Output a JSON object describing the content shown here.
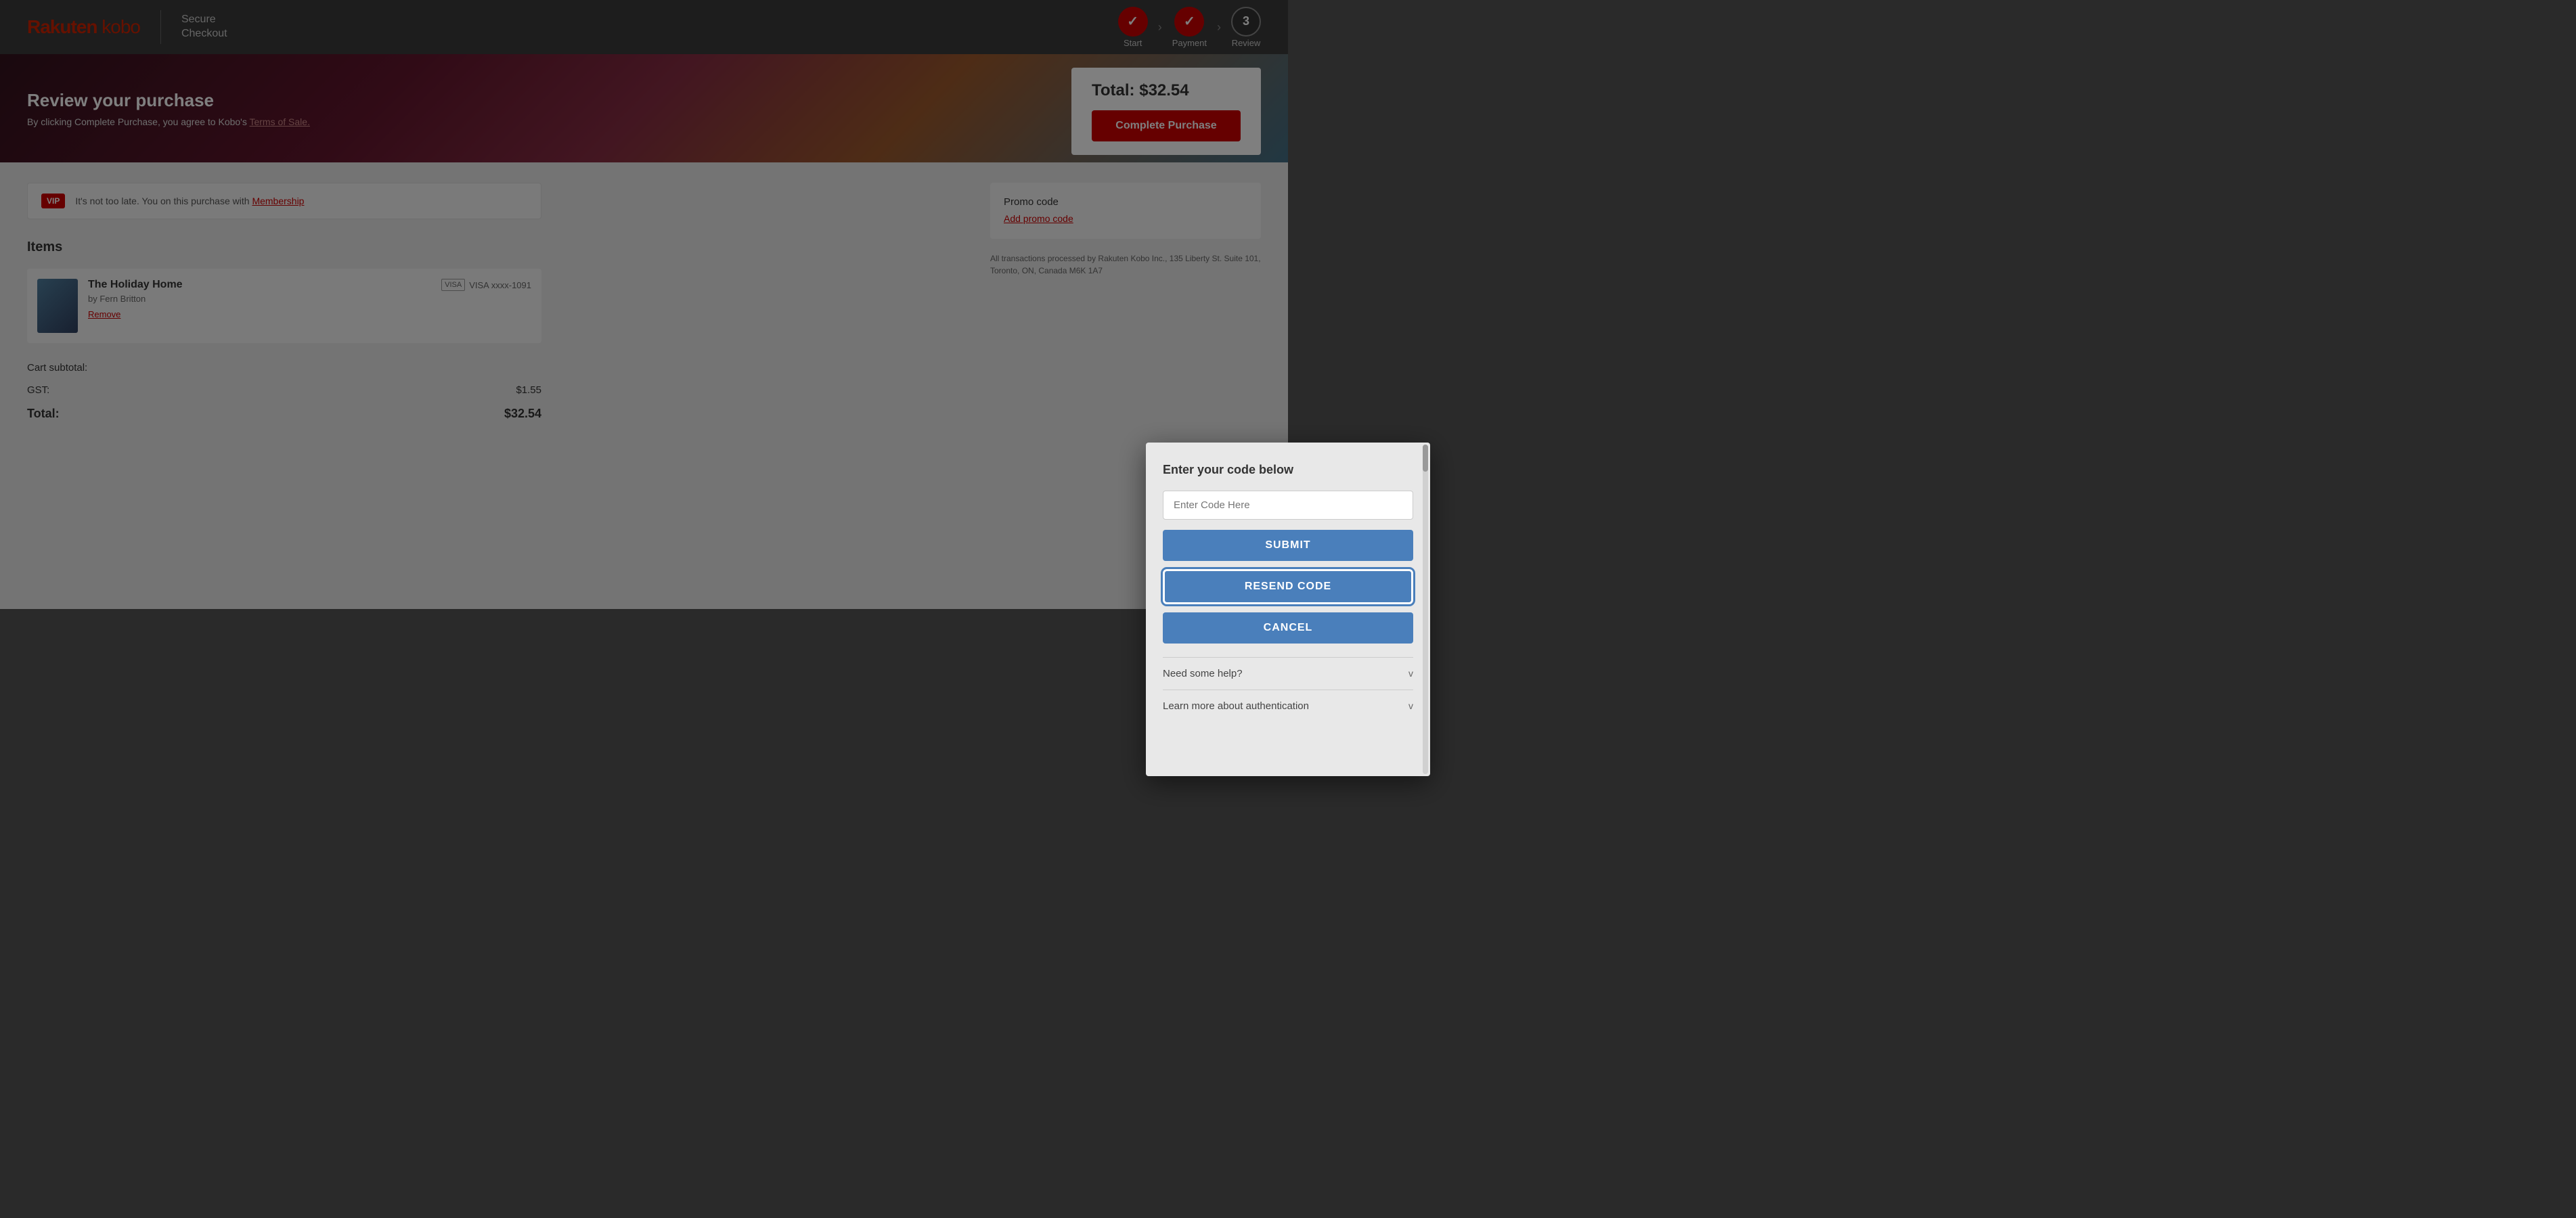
{
  "header": {
    "logo_rakuten": "Rakuten",
    "logo_kobo": "kobo",
    "secure_checkout_line1": "Secure",
    "secure_checkout_line2": "Checkout",
    "steps": [
      {
        "label": "Start",
        "state": "done",
        "symbol": "✓"
      },
      {
        "label": "Payment",
        "state": "done",
        "symbol": "✓"
      },
      {
        "label": "Review",
        "state": "active",
        "symbol": "3"
      }
    ]
  },
  "hero": {
    "title": "Review your purchase",
    "subtitle_text": "By clicking Complete Purchase, you agree to Kobo's",
    "subtitle_link": "Terms of Sale.",
    "total_label": "Total:",
    "total_amount": "$32.54",
    "complete_purchase_btn": "Complete Purchase"
  },
  "vip": {
    "badge": "VIP",
    "text": "It's not too late. You",
    "text2": "on this purchase with",
    "link": "Membership"
  },
  "items": {
    "section_title": "Items",
    "list": [
      {
        "title": "The Holiday Home",
        "author": "by Fern Britton",
        "remove_label": "Remove"
      }
    ]
  },
  "totals": {
    "subtotal_label": "Cart subtotal:",
    "gst_label": "GST:",
    "gst_value": "$1.55",
    "total_label": "Total:",
    "total_value": "$32.54"
  },
  "right_panel": {
    "visa_label": "VISA xxxx-1091",
    "promo_title": "Promo code",
    "promo_link": "Add promo code",
    "legal": "All transactions processed by Rakuten Kobo Inc., 135 Liberty St. Suite 101, Toronto, ON, Canada M6K 1A7"
  },
  "modal": {
    "title": "Enter your code below",
    "input_placeholder": "Enter Code Here",
    "submit_btn": "SUBMIT",
    "resend_btn": "RESEND CODE",
    "cancel_btn": "CANCEL",
    "accordion1": "Need some help?",
    "accordion2": "Learn more about authentication",
    "chevron": "v"
  }
}
